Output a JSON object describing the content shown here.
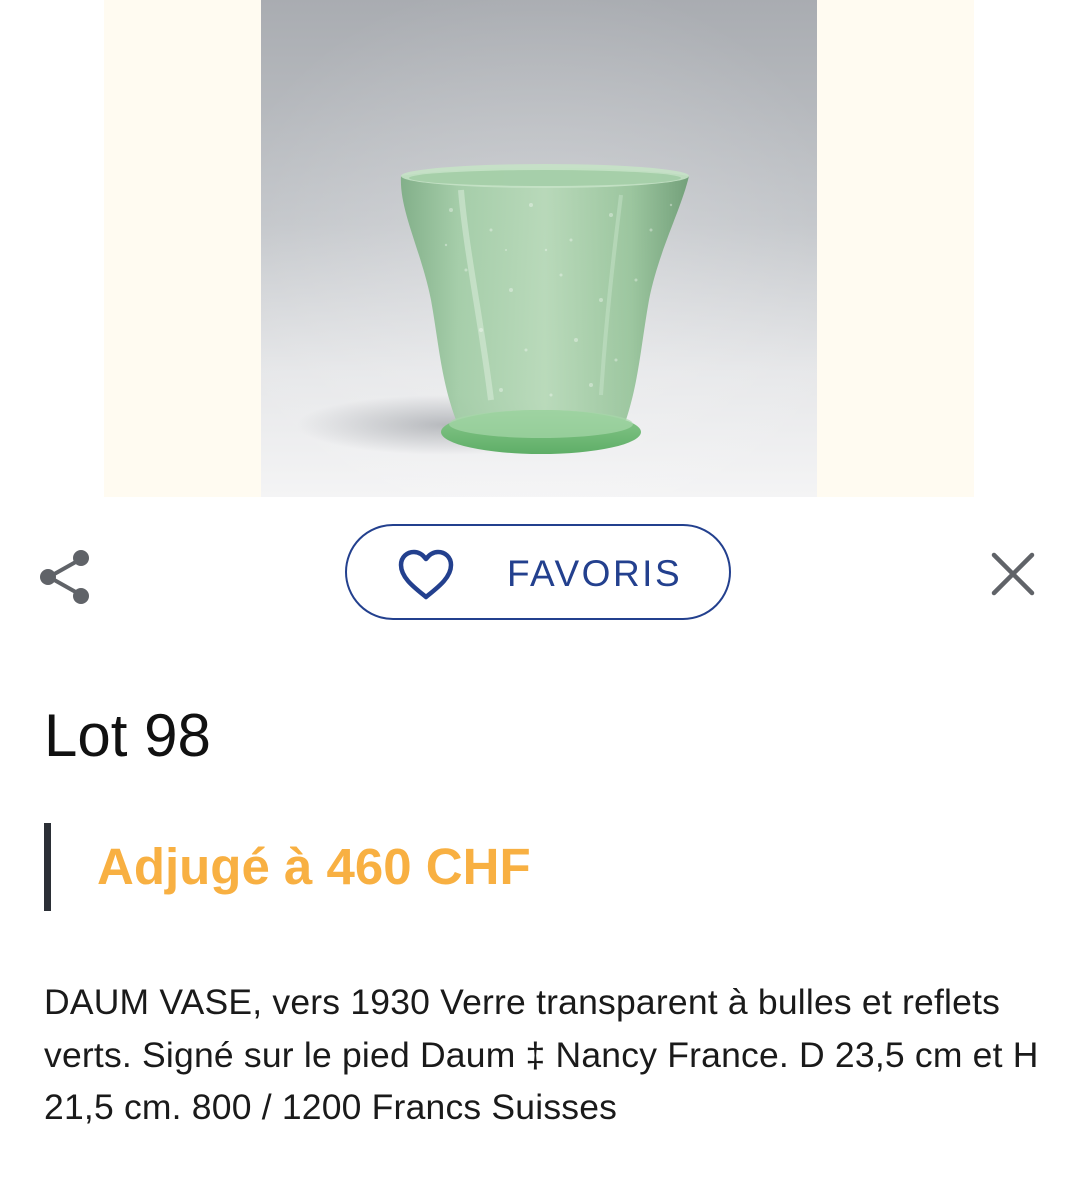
{
  "lot": {
    "title": "Lot 98",
    "sold_label": "Adjugé à 460 CHF",
    "description": "DAUM VASE, vers 1930 Verre transparent à bulles et reflets verts. Signé sur le pied Daum ‡ Nancy France. D 23,5 cm et H 21,5 cm. 800 / 1200 Francs Suisses"
  },
  "actions": {
    "favorites_label": "FAVORIS",
    "share_icon": "share-icon",
    "favorite_icon": "heart-outline-icon",
    "close_icon": "close-icon"
  },
  "colors": {
    "accent_blue": "#23408e",
    "sold_orange": "#f8b042",
    "frame_cream": "#fffbf1"
  }
}
